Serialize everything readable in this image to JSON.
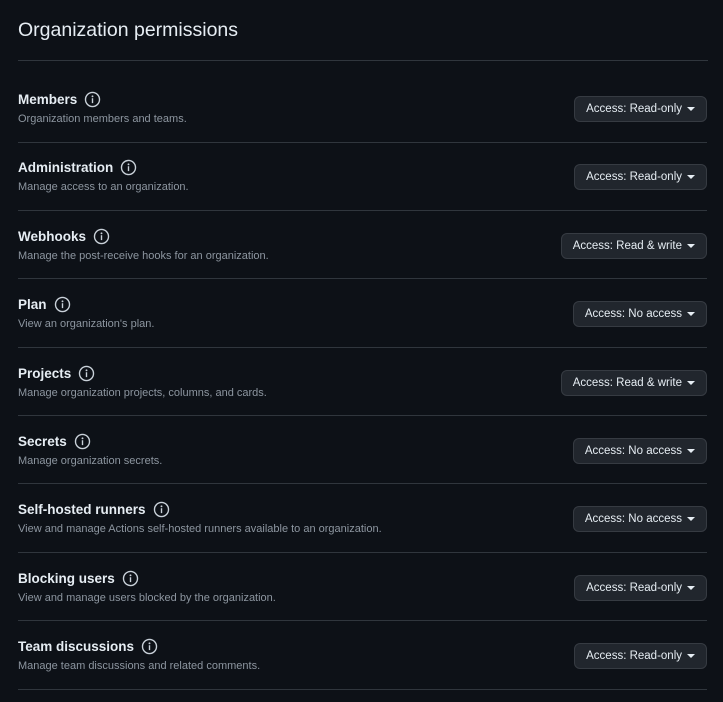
{
  "page": {
    "title": "Organization permissions"
  },
  "permissions": [
    {
      "name": "Members",
      "description": "Organization members and teams.",
      "access": "Access: Read-only"
    },
    {
      "name": "Administration",
      "description": "Manage access to an organization.",
      "access": "Access: Read-only"
    },
    {
      "name": "Webhooks",
      "description": "Manage the post-receive hooks for an organization.",
      "access": "Access: Read & write"
    },
    {
      "name": "Plan",
      "description": "View an organization's plan.",
      "access": "Access: No access"
    },
    {
      "name": "Projects",
      "description": "Manage organization projects, columns, and cards.",
      "access": "Access: Read & write"
    },
    {
      "name": "Secrets",
      "description": "Manage organization secrets.",
      "access": "Access: No access"
    },
    {
      "name": "Self-hosted runners",
      "description": "View and manage Actions self-hosted runners available to an organization.",
      "access": "Access: No access"
    },
    {
      "name": "Blocking users",
      "description": "View and manage users blocked by the organization.",
      "access": "Access: Read-only"
    },
    {
      "name": "Team discussions",
      "description": "Manage team discussions and related comments.",
      "access": "Access: Read-only"
    }
  ],
  "icons": {
    "info": "info-icon",
    "dropdown": "caret-down-icon"
  },
  "colors": {
    "background": "#0d1117",
    "text": "#e6edf3",
    "muted": "#8d96a0",
    "border": "#30363d",
    "button_bg": "#21262d"
  }
}
